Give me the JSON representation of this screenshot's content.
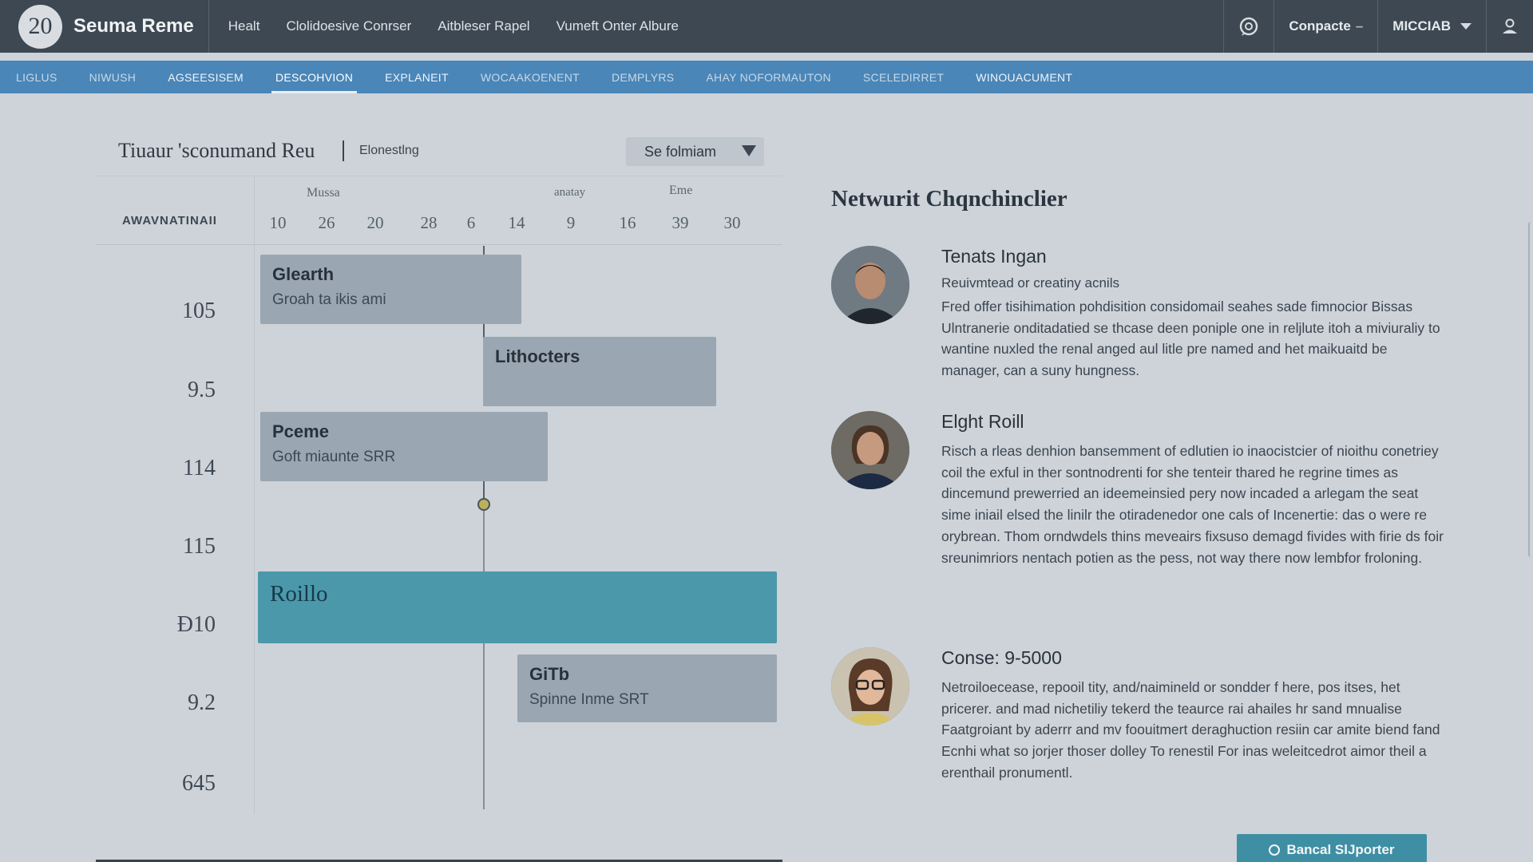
{
  "header": {
    "logo_text": "20",
    "app_title": "Seuma Reme",
    "nav": [
      "Healt",
      "Clolidoesive Conrser",
      "Aitbleser Rapel",
      "Vumeft Onter Albure"
    ],
    "contact_label": "Conpacte",
    "user_label": "MICCIAB",
    "icons": [
      "chat-icon",
      "user-icon"
    ]
  },
  "tabs": [
    "LIGLUS",
    "NIWUSH",
    "AGSEESISEM",
    "DESCOHVION",
    "EXPLANEIT",
    "WOCAAKOENENT",
    "DEMPLYRS",
    "AHAY NOFORMAUTON",
    "SCELEDIRRET",
    "WINOUACUMENT"
  ],
  "active_tab": "DESCOHVION",
  "schedule": {
    "title": "Tiuaur 'sconumand Reu",
    "subtitle": "Elonestlng",
    "filter_label": "Se folmiam",
    "row_header": "AWAVNATINAII",
    "group_labels": [
      "Mussa",
      "anatay",
      "Eme"
    ],
    "ticks": [
      "10",
      "26",
      "20",
      "28",
      "6",
      "14",
      "9",
      "16",
      "39",
      "30"
    ],
    "row_labels": [
      "105",
      "9.5",
      "114",
      "115",
      "Ð10",
      "9.2",
      "645"
    ],
    "bars": [
      {
        "title": "Glearth",
        "sub": "Groah ta ikis ami"
      },
      {
        "title": "Lithocters",
        "sub": ""
      },
      {
        "title": "Pceme",
        "sub": "Goft miaunte SRR"
      },
      {
        "title": "Roillo",
        "sub": ""
      },
      {
        "title": "GiTb",
        "sub": "Spinne Inme SRT"
      }
    ]
  },
  "people_panel": {
    "title": "Netwurit Chqnchinclier",
    "people": [
      {
        "name": "Tenats Ingan",
        "role": "Reuivmtead or creatiny acnils",
        "bio": "Fred offer tisihimation pohdisition considomail seahes sade fimnocior Bissas Ulntranerie onditadatied se thcase deen poniple one in reljlute itoh a miviuraliy to wantine nuxled the renal anged aul litle pre named and het maikuaitd be manager, can a suny hungness."
      },
      {
        "name": "Elght Roill",
        "role": "",
        "bio": "Risch a rleas denhion bansemment of edlutien io inaocistcier of nioithu conetriey coil the exful in ther sontnodrenti for she tenteir thared he regrine times as dincemund prewerried an ideemeinsied pery now incaded a arlegam the seat sime iniail elsed the linilr the otiradenedor one cals of Incenertie: das o were re orybrean. Thom orndwdels thins meveairs fixsuso demagd fivides with firie ds foir sreunimriors nentach potien as the pess, not way there now lembfor froloning."
      },
      {
        "name": "Conse: 9-5000",
        "role": "",
        "bio": "Netroiloecease, repooil tity, and/naimineld or sondder f here, pos itses, het pricerer. and mad nichetiliy tekerd the teaurce rai ahailes hr sand mnualise Faatgroiant by aderrr and mv foouitmert deraghuction resiin car amite biend fand Ecnhi what so jorjer thoser dolley To renestil For inas weleitcedrot aimor theil a erenthail pronumentl."
      }
    ],
    "support_button": "Bancal SlJporter"
  },
  "colors": {
    "topbar": "#3d4853",
    "tabbar": "#4a86b8",
    "accent_bar": "#4b98ab",
    "background": "#cdd3d9"
  }
}
